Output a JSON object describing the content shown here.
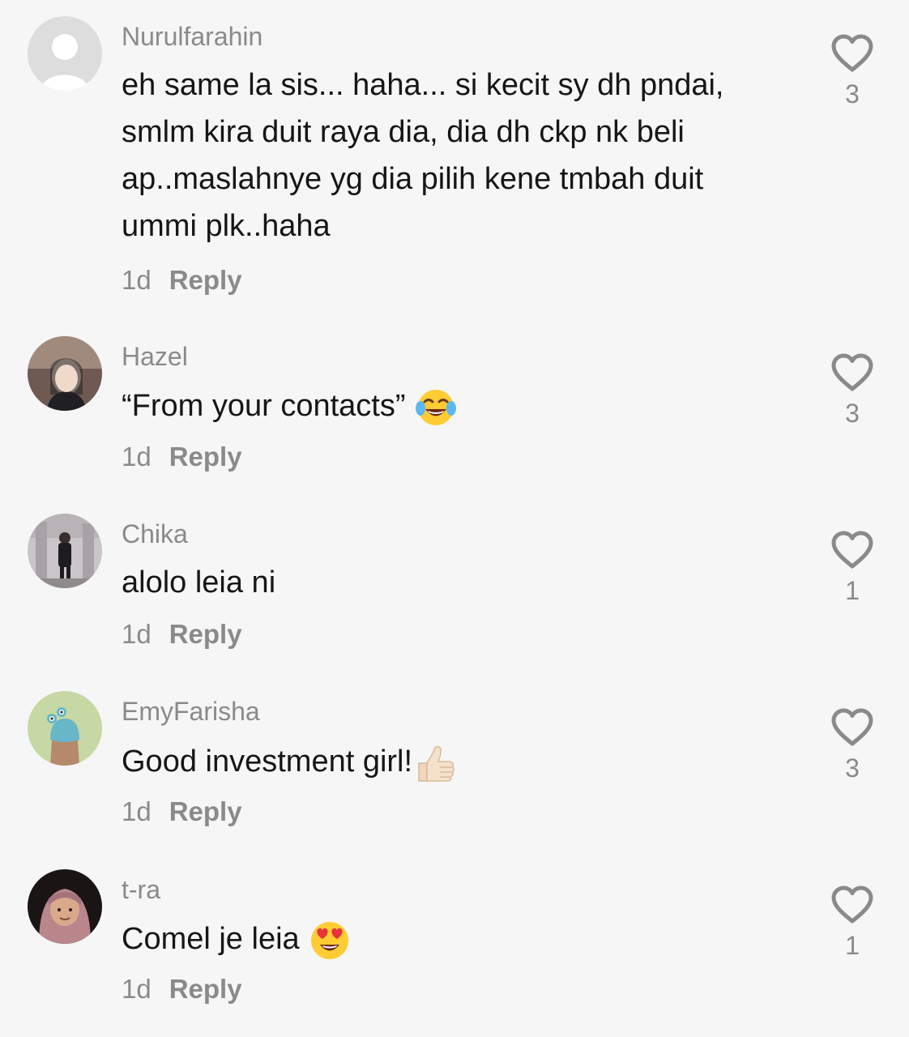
{
  "comments": [
    {
      "username": "Nurulfarahin",
      "lines": [
        "eh same la sis... haha... si kecit sy dh pndai,",
        "smlm kira duit raya dia, dia dh ckp nk beli",
        "ap..maslahnye yg dia pilih kene tmbah duit",
        "ummi plk..haha"
      ],
      "time": "1d",
      "reply": "Reply",
      "likes": "3",
      "avatar": "default-avatar-icon"
    },
    {
      "username": "Hazel",
      "lines": [
        "“From your contacts”"
      ],
      "emoji": "tears-of-joy-emoji",
      "time": "1d",
      "reply": "Reply",
      "likes": "3",
      "avatar": "user-photo"
    },
    {
      "username": "Chika",
      "lines": [
        "alolo leia ni"
      ],
      "time": "1d",
      "reply": "Reply",
      "likes": "1",
      "avatar": "user-photo"
    },
    {
      "username": "EmyFarisha",
      "lines": [
        "Good investment girl!"
      ],
      "emoji": "thumbs-up-emoji",
      "time": "1d",
      "reply": "Reply",
      "likes": "3",
      "avatar": "user-photo"
    },
    {
      "username": "t-ra",
      "lines": [
        "Comel je leia"
      ],
      "emoji": "heart-eyes-emoji",
      "time": "1d",
      "reply": "Reply",
      "likes": "1",
      "avatar": "user-photo"
    }
  ],
  "colors": {
    "background": "#f6f6f6",
    "text": "#161616",
    "muted": "#8a8a8a",
    "like_outline": "#8a8a8a"
  }
}
